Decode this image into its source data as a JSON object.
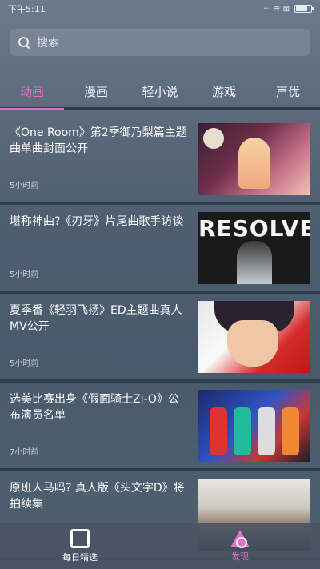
{
  "status_bar": {
    "time": "下午5:11",
    "indicators": "··· ≋ ⊠"
  },
  "search": {
    "placeholder": "搜索"
  },
  "tabs": [
    {
      "label": "动画",
      "active": true
    },
    {
      "label": "漫画",
      "active": false
    },
    {
      "label": "轻小说",
      "active": false
    },
    {
      "label": "游戏",
      "active": false
    },
    {
      "label": "声优",
      "active": false
    }
  ],
  "articles": [
    {
      "title": "《One Room》第2季御乃梨篇主题曲单曲封面公开",
      "time": "5小时前"
    },
    {
      "title": "堪称神曲?《刃牙》片尾曲歌手访谈",
      "time": "5小时前"
    },
    {
      "title": "夏季番《轻羽飞扬》ED主题曲真人MV公开",
      "time": "5小时前"
    },
    {
      "title": "选美比赛出身《假面骑士Zi-O》公布演员名单",
      "time": "7小时前"
    },
    {
      "title": "原班人马吗? 真人版《头文字D》将拍续集",
      "time": ""
    }
  ],
  "thumb_text": {
    "resolve": "RESOLVE"
  },
  "bottom_nav": [
    {
      "label": "每日精选",
      "icon": "square-frame-icon",
      "active": false
    },
    {
      "label": "发现",
      "icon": "triangle-eye-icon",
      "active": true
    }
  ],
  "colors": {
    "accent": "#e56fc4",
    "divider": "#2e3d50"
  }
}
